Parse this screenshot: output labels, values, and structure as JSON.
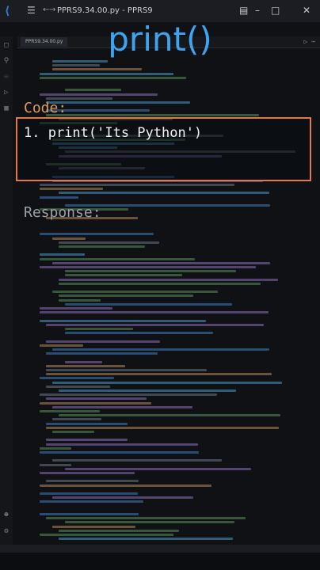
{
  "window": {
    "title": "PPRS9.34.00.py - PPRS9",
    "tab_label": "PPRS9.34.00.py"
  },
  "overlay": {
    "title": "print()",
    "code_label": "Code:",
    "code_line": "1. print('Its Python')",
    "response_label": "Response:"
  },
  "colors": {
    "accent_blue": "#3ea4f0",
    "code_label": "#e09a5a",
    "box_border": "#e0784a"
  },
  "icons": {
    "logo": "vscode-icon",
    "menu": "hamburger-icon",
    "back": "arrow-left-icon",
    "forward": "arrow-right-icon"
  }
}
